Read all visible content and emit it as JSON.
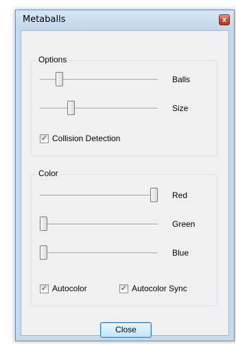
{
  "window": {
    "title": "Metaballs",
    "close_glyph": "x"
  },
  "options": {
    "group_label": "Options",
    "sliders": [
      {
        "label": "Balls",
        "value_fraction": 0.14
      },
      {
        "label": "Size",
        "value_fraction": 0.25
      }
    ],
    "checkboxes": [
      {
        "label": "Collision Detection",
        "checked": true
      }
    ]
  },
  "color": {
    "group_label": "Color",
    "sliders": [
      {
        "label": "Red",
        "value_fraction": 1.0
      },
      {
        "label": "Green",
        "value_fraction": 0.0
      },
      {
        "label": "Blue",
        "value_fraction": 0.0
      }
    ],
    "checkboxes": [
      {
        "label": "Autocolor",
        "checked": true
      },
      {
        "label": "Autocolor Sync",
        "checked": true
      }
    ]
  },
  "buttons": {
    "close_label": "Close"
  },
  "check_glyph": "✓"
}
